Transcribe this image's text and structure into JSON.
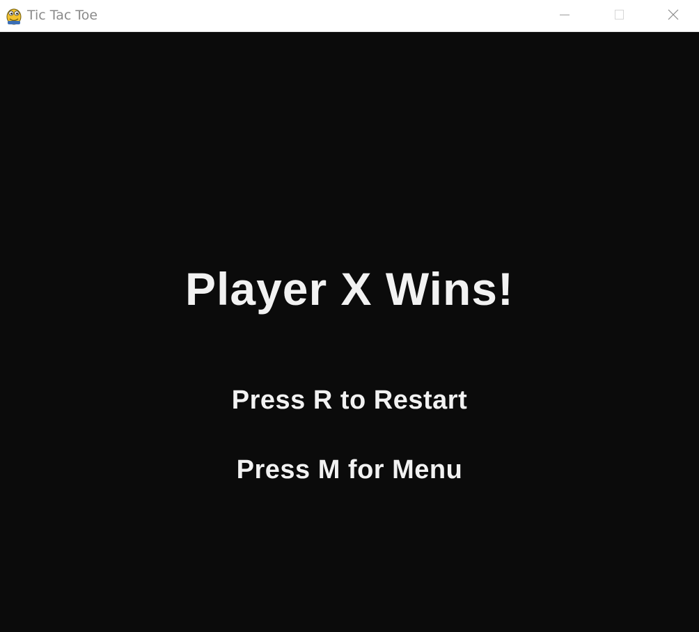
{
  "window": {
    "title": "Tic Tac Toe",
    "app_icon": "pygame-snake-icon",
    "controls": [
      "minimize-icon",
      "maximize-icon",
      "close-icon"
    ]
  },
  "game_over": {
    "result_text": "Player X Wins!",
    "restart_hint": "Press R to Restart",
    "menu_hint": "Press M for Menu"
  },
  "colors": {
    "background": "#0b0b0b",
    "text": "#f2f2f2",
    "titlebar": "#ffffff",
    "title_text": "#8a8a8a"
  }
}
